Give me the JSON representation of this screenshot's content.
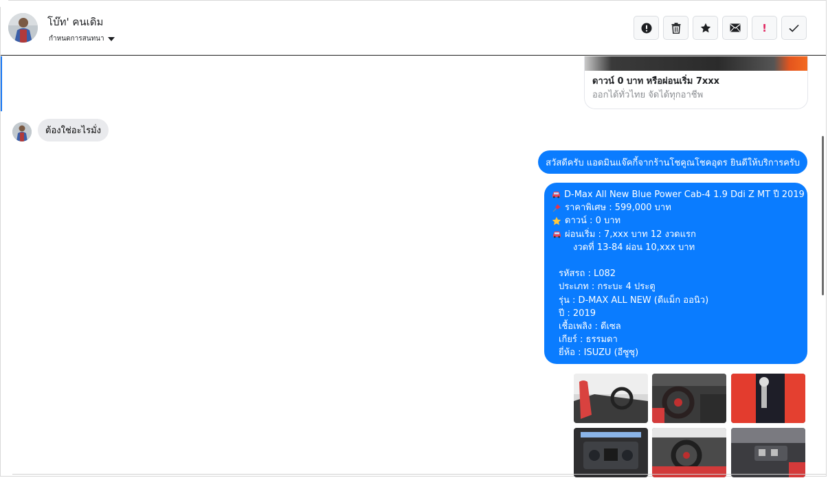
{
  "header": {
    "contact_name": "โบ๊ท' คนเดิม",
    "subtitle": "กำหนดการสนทนา",
    "actions": [
      {
        "name": "exclamation-circle-icon",
        "label": ""
      },
      {
        "name": "trash-icon",
        "label": ""
      },
      {
        "name": "star-icon",
        "label": ""
      },
      {
        "name": "envelope-icon",
        "label": ""
      },
      {
        "name": "exclamation-icon",
        "label": "!"
      },
      {
        "name": "check-icon",
        "label": ""
      }
    ]
  },
  "card": {
    "title": "ดาวน์ 0 บาท หรือผ่อนเริ่ม 7xxx",
    "subtitle": "ออกได้ทั่วไทย จัดได้ทุกอาชีพ"
  },
  "incoming": {
    "text": "ต้องใช่อะไรมั่ง"
  },
  "outgoing": {
    "greeting": "สวัสดีครับ แอดมินแจ๊คกี้จากร้านโชคูณโชคอุดร ยินดีให้บริการครับ",
    "details": {
      "model_line": "D-Max All New Blue Power Cab-4 1.9 Ddi Z MT ปี 2019",
      "price_line": "ราคาพิเศษ : 599,000 บาท",
      "down_line": "ดาวน์ : 0 บาท",
      "installment_line": "ผ่อนเริ่ม : 7,xxx บาท 12 งวดแรก",
      "installment_line2": "งวดที่ 13-84 ผ่อน 10,xxx บาท",
      "code_line": "รหัสรถ : L082",
      "type_line": "ประเภท : กระบะ 4 ประตู",
      "version_line": "รุ่น : D-MAX ALL NEW (ดีแม็ก ออนิว)",
      "year_line": "ปี : 2019",
      "fuel_line": "เชื้อเพลิง : ดีเซล",
      "gear_line": "เกียร์ : ธรรมดา",
      "brand_line": "ยี่ห้อ : ISUZU (อีซูซุ)"
    }
  },
  "icons": {
    "model": "car-icon",
    "price": "pushpin-icon",
    "down": "star-icon",
    "installment": "car-icon"
  },
  "colors": {
    "accent": "#0a7cff",
    "incoming_bubble": "#e9eaed",
    "muted_text": "#8a8d91"
  }
}
